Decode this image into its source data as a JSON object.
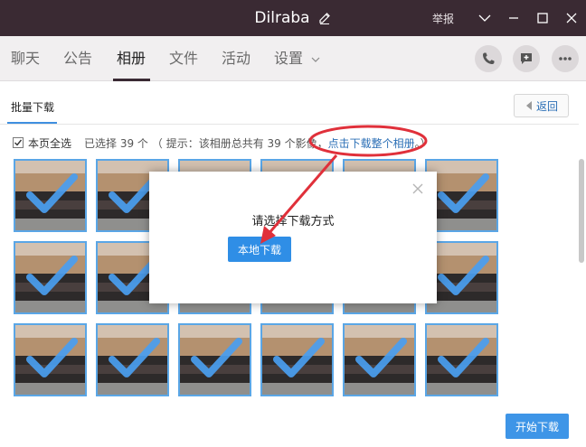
{
  "window": {
    "title": "Dilraba",
    "report_label": "举报",
    "title_bg": "#3a2a33"
  },
  "tabs": [
    {
      "label": "聊天"
    },
    {
      "label": "公告"
    },
    {
      "label": "相册",
      "active": true
    },
    {
      "label": "文件"
    },
    {
      "label": "活动"
    },
    {
      "label": "设置"
    }
  ],
  "subbar": {
    "batch_tab": "批量下载",
    "back_label": "返回"
  },
  "selection": {
    "select_all_label": "本页全选",
    "selected_text": "已选择 39 个",
    "hint_text": "（ 提示：该相册总共有 39 个影像，",
    "hint_link": "点击下载整个相册",
    "hint_end": "。）",
    "checked": true
  },
  "modal": {
    "title": "请选择下载方式",
    "local_download": "本地下载"
  },
  "footer": {
    "start_download": "开始下载"
  },
  "colors": {
    "accent": "#3e95e7",
    "link": "#2b6fb6",
    "annotation": "#e0303a"
  }
}
